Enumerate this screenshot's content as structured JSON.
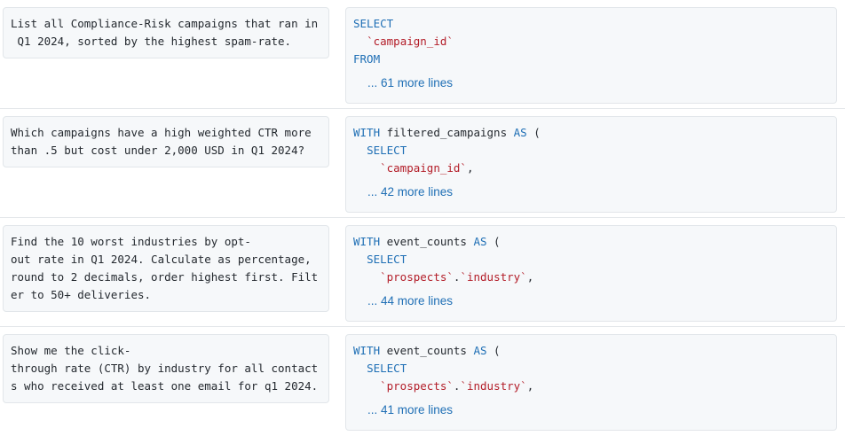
{
  "rows": [
    {
      "prompt": "List all Compliance-Risk campaigns that ran in\n Q1 2024, sorted by the highest spam-rate.",
      "code": [
        [
          {
            "t": "SELECT",
            "c": "kw"
          }
        ],
        [
          {
            "t": "  ",
            "c": ""
          },
          {
            "t": "`campaign_id`",
            "c": "str"
          }
        ],
        [
          {
            "t": "FROM",
            "c": "kw"
          }
        ]
      ],
      "more": "... 61 more lines"
    },
    {
      "prompt": "Which campaigns have a high weighted CTR more\nthan .5 but cost under 2,000 USD in Q1 2024?",
      "code": [
        [
          {
            "t": "WITH",
            "c": "kw"
          },
          {
            "t": " filtered_campaigns ",
            "c": ""
          },
          {
            "t": "AS",
            "c": "kw"
          },
          {
            "t": " (",
            "c": ""
          }
        ],
        [
          {
            "t": "  ",
            "c": ""
          },
          {
            "t": "SELECT",
            "c": "kw"
          }
        ],
        [
          {
            "t": "    ",
            "c": ""
          },
          {
            "t": "`campaign_id`",
            "c": "str"
          },
          {
            "t": ",",
            "c": ""
          }
        ]
      ],
      "more": "... 42 more lines"
    },
    {
      "prompt": "Find the 10 worst industries by opt-\nout rate in Q1 2024. Calculate as percentage,\nround to 2 decimals, order highest first. Filt\ner to 50+ deliveries.",
      "code": [
        [
          {
            "t": "WITH",
            "c": "kw"
          },
          {
            "t": " event_counts ",
            "c": ""
          },
          {
            "t": "AS",
            "c": "kw"
          },
          {
            "t": " (",
            "c": ""
          }
        ],
        [
          {
            "t": "  ",
            "c": ""
          },
          {
            "t": "SELECT",
            "c": "kw"
          }
        ],
        [
          {
            "t": "    ",
            "c": ""
          },
          {
            "t": "`prospects`",
            "c": "str"
          },
          {
            "t": ".",
            "c": ""
          },
          {
            "t": "`industry`",
            "c": "str"
          },
          {
            "t": ",",
            "c": ""
          }
        ]
      ],
      "more": "... 44 more lines"
    },
    {
      "prompt": "Show me the click-\nthrough rate (CTR) by industry for all contact\ns who received at least one email for q1 2024.",
      "code": [
        [
          {
            "t": "WITH",
            "c": "kw"
          },
          {
            "t": " event_counts ",
            "c": ""
          },
          {
            "t": "AS",
            "c": "kw"
          },
          {
            "t": " (",
            "c": ""
          }
        ],
        [
          {
            "t": "  ",
            "c": ""
          },
          {
            "t": "SELECT",
            "c": "kw"
          }
        ],
        [
          {
            "t": "    ",
            "c": ""
          },
          {
            "t": "`prospects`",
            "c": "str"
          },
          {
            "t": ".",
            "c": ""
          },
          {
            "t": "`industry`",
            "c": "str"
          },
          {
            "t": ",",
            "c": ""
          }
        ]
      ],
      "more": "... 41 more lines"
    }
  ]
}
